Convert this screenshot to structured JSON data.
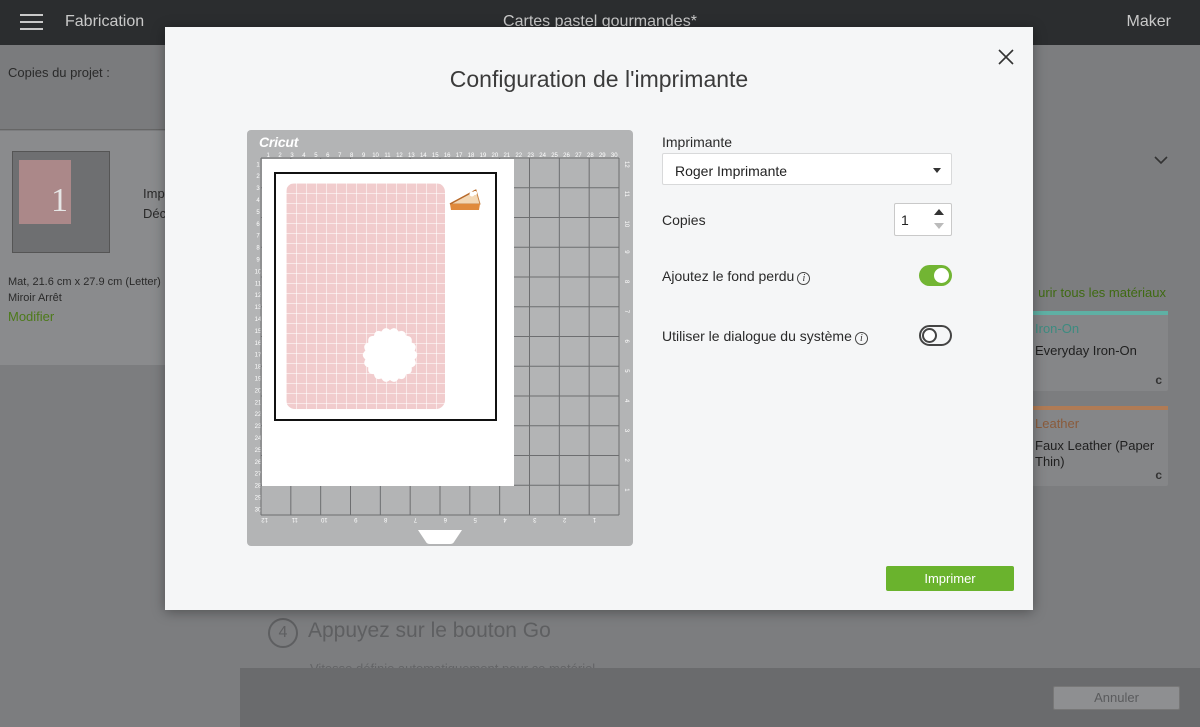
{
  "topbar": {
    "app_name": "Fabrication",
    "project_name": "Cartes pastel gourmandes*",
    "machine_name": "Maker"
  },
  "left_panel": {
    "copies_label": "Copies du projet :",
    "item_line1": "Imp",
    "item_line2": "Déc",
    "thumb_number": "1",
    "mat_info": "Mat, 21.6 cm x 27.9 cm (Letter)",
    "mirror_info": "Miroir Arrêt",
    "modify_link": "Modifier"
  },
  "main_bg": {
    "browse_materials": "urir tous les matériaux",
    "materials": [
      {
        "type": "Iron-On",
        "name": "Everyday Iron-On",
        "accent": "#5fb0a4",
        "corner": "c"
      },
      {
        "type": "Leather",
        "name": "Faux Leather (Paper Thin)",
        "accent": "#b07b55",
        "corner": "c"
      }
    ],
    "step4": {
      "number": "4",
      "title": "Appuyez sur le bouton Go",
      "subtitle": "Vitesse définie automatiquement pour ce matériel"
    },
    "cancel_label": "Annuler"
  },
  "modal": {
    "title": "Configuration de l'imprimante",
    "mat": {
      "brand": "Cricut",
      "top_ruler": [
        "1",
        "2",
        "3",
        "4",
        "5",
        "6",
        "7",
        "8",
        "9",
        "10",
        "11",
        "12",
        "13",
        "14",
        "15",
        "16",
        "17",
        "18",
        "19",
        "20",
        "21",
        "22",
        "23",
        "24",
        "25",
        "26",
        "27",
        "28",
        "29",
        "30"
      ],
      "left_ruler": [
        "1",
        "2",
        "3",
        "4",
        "5",
        "6",
        "7",
        "8",
        "9",
        "10",
        "11",
        "12",
        "13",
        "14",
        "15",
        "16",
        "17",
        "18",
        "19",
        "20",
        "21",
        "22",
        "23",
        "24",
        "25",
        "26",
        "27",
        "28",
        "29",
        "30"
      ],
      "right_ruler": [
        "12",
        "11",
        "10",
        "9",
        "8",
        "7",
        "6",
        "5",
        "4",
        "3",
        "2",
        "1"
      ],
      "bottom_ruler": [
        "12",
        "11",
        "10",
        "9",
        "8",
        "7",
        "6",
        "5",
        "4",
        "3",
        "2",
        "1"
      ]
    },
    "printer_label": "Imprimante",
    "printer_value": "Roger Imprimante",
    "copies_label": "Copies",
    "copies_value": "1",
    "bleed_label": "Ajoutez le fond perdu",
    "bleed_on": true,
    "system_dialog_label": "Utiliser le dialogue du système",
    "system_dialog_on": false,
    "print_label": "Imprimer",
    "accent": "#6ab32d"
  }
}
